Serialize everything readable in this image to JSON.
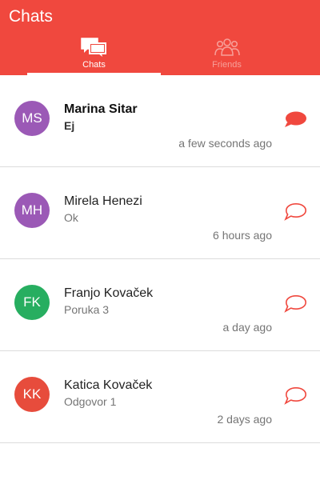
{
  "appbar": {
    "title": "Chats",
    "color": "#f0483e"
  },
  "tabs": [
    {
      "label": "Chats",
      "icon": "chat-bubbles-icon",
      "selected": true
    },
    {
      "label": "Friends",
      "icon": "people-icon",
      "selected": false
    }
  ],
  "chats": [
    {
      "initials": "MS",
      "name": "Marina Sitar",
      "message": "Ej",
      "time": "a few seconds ago",
      "unread": true,
      "avatar_color": "#9b59b6"
    },
    {
      "initials": "MH",
      "name": "Mirela Henezi",
      "message": "Ok",
      "time": "6 hours ago",
      "unread": false,
      "avatar_color": "#9b59b6"
    },
    {
      "initials": "FK",
      "name": "Franjo Kovaček",
      "message": "Poruka 3",
      "time": "a day ago",
      "unread": false,
      "avatar_color": "#27ae60"
    },
    {
      "initials": "KK",
      "name": "Katica Kovaček",
      "message": "Odgovor 1",
      "time": "2 days ago",
      "unread": false,
      "avatar_color": "#e74c3c"
    }
  ]
}
